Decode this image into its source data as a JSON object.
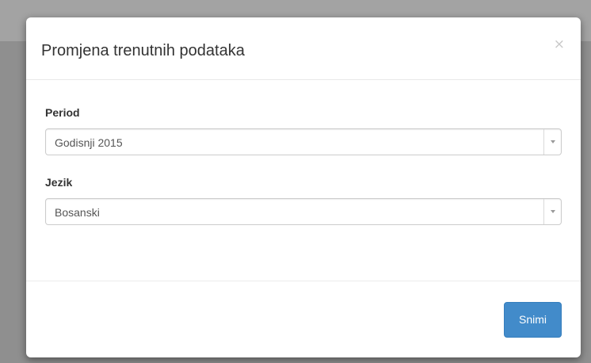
{
  "modal": {
    "title": "Promjena trenutnih podataka",
    "close_glyph": "×",
    "fields": [
      {
        "label": "Period",
        "value": "Godisnji 2015"
      },
      {
        "label": "Jezik",
        "value": "Bosanski"
      }
    ],
    "save_label": "Snimi"
  },
  "colors": {
    "primary_button": "#428bca",
    "backdrop": "#8f8f8f"
  },
  "icons": {
    "close": "close-icon",
    "dropdown": "chevron-down-icon"
  }
}
